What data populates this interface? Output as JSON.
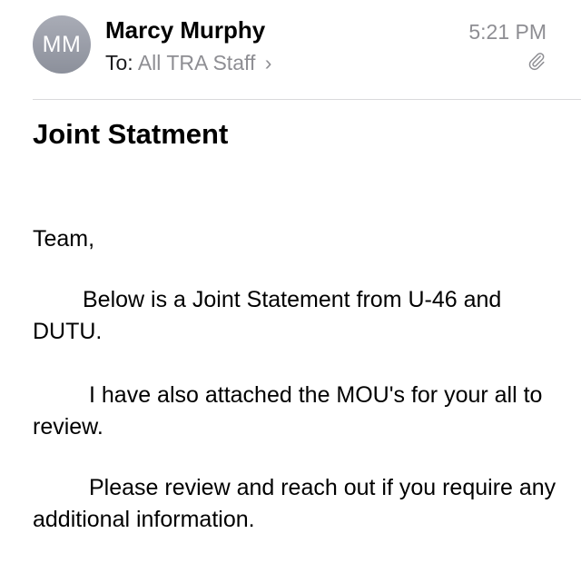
{
  "header": {
    "avatar_initials": "MM",
    "sender_name": "Marcy Murphy",
    "to_label": "To:",
    "recipients": "All TRA Staff",
    "chevron": "›",
    "time": "5:21 PM",
    "attachment_icon": "paperclip-icon"
  },
  "message": {
    "subject": "Joint Statment",
    "greeting": "Team,",
    "paragraphs": [
      "Below is a Joint Statement from U-46 and DUTU.",
      "I have also attached the MOU's for your all to review.",
      "Please review and reach out if you require any additional information."
    ]
  },
  "colors": {
    "secondary_text": "#8e8e93",
    "avatar_bg": "#9a9ea8",
    "divider": "#d9d9dc"
  }
}
